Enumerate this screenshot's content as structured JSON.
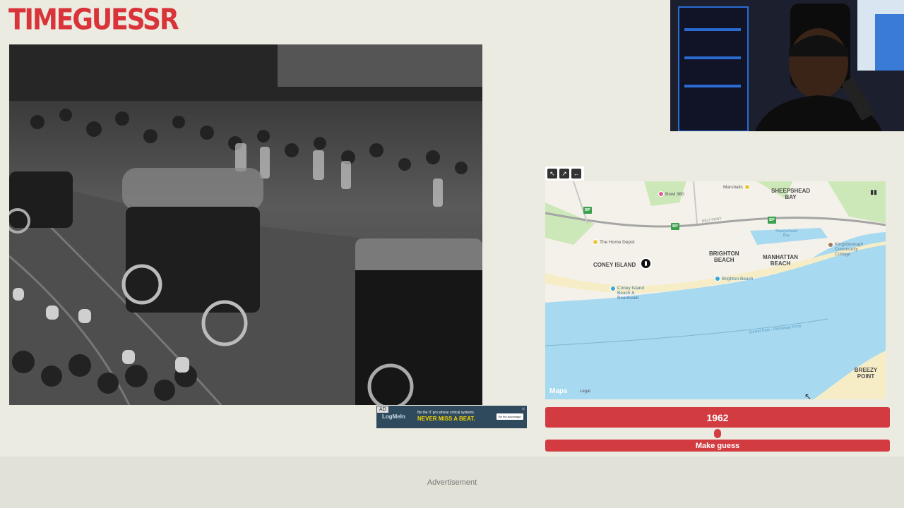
{
  "app": {
    "logo_text": "TIMEGUESSR"
  },
  "photo": {
    "description_icon": "historic-street-photo"
  },
  "ad_small": {
    "tag": "AD",
    "brand": "LogMeIn",
    "line1": "Be the IT pro whose critical systems",
    "line2": "NEVER MISS A BEAT.",
    "cta": "Be the Advantage",
    "close_icon": "close-icon"
  },
  "map": {
    "tools": [
      "arrow-nw-icon",
      "arrow-ne-icon",
      "arrow-left-icon"
    ],
    "labels": {
      "coney_island": "CONEY ISLAND",
      "brighton_beach": "BRIGHTON\nBEACH",
      "manhattan_beach": "MANHATTAN\nBEACH",
      "sheepshead_bay": "SHEEPSHEAD\nBAY",
      "breezy_point": "BREEZY POINT"
    },
    "pois": {
      "bowl": "Bowl 360",
      "marshalls": "Marshalls",
      "home_depot": "The Home Depot",
      "kingsborough": "Kingsborough\nCommunity\nCollege",
      "brighton_beach_station": "Brighton Beach",
      "coney_beach": "Coney Island\nBeach &\nBoardwalk",
      "belt_pkwy": "BELT PKWY",
      "sheepshead_water": "Sheepshead\nBay",
      "ferry": "Sunset Park - Rockaway Ferry"
    },
    "highway_shield": "BP",
    "brand": "Maps",
    "legal": "Legal"
  },
  "controls": {
    "year": "1962",
    "slider_value": 0.5,
    "guess_label": "Make guess"
  },
  "footer": {
    "ad_label": "Advertisement"
  },
  "colors": {
    "accent": "#d23b40",
    "background": "#ecebe1",
    "water": "#a7d9f0"
  }
}
